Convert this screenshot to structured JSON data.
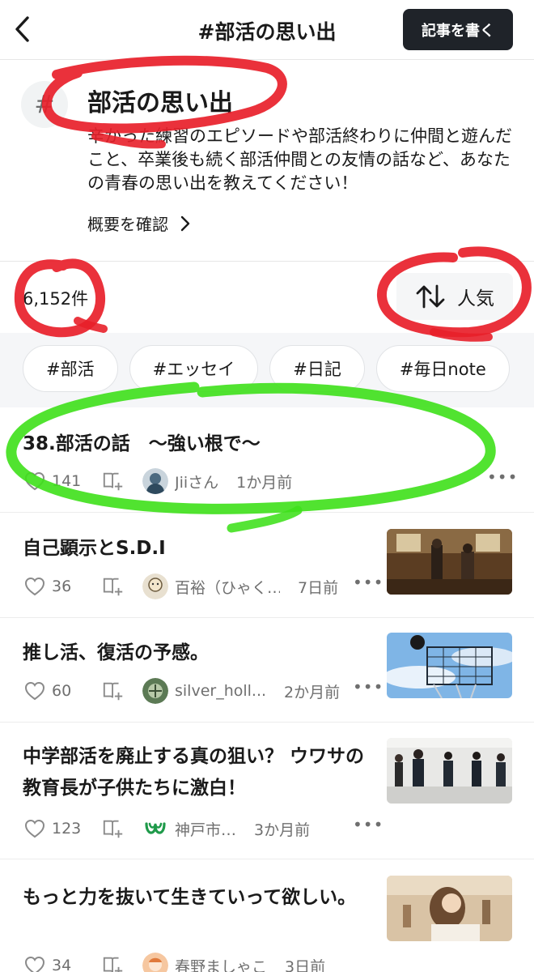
{
  "header": {
    "title": "#部活の思い出",
    "write_label": "記事を書く"
  },
  "tag": {
    "hash": "#",
    "title": "部活の思い出",
    "description": "辛かった練習のエピソードや部活終わりに仲間と遊んだこと、卒業後も続く部活仲間との友情の話など、あなたの青春の思い出を教えてください！",
    "overview_label": "概要を確認"
  },
  "list": {
    "count": "6,152件",
    "sort_label": "人気"
  },
  "chips": [
    "#部活",
    "#エッセイ",
    "#日記",
    "#毎日note"
  ],
  "articles": [
    {
      "title": "38.部活の話　〜強い根で〜",
      "likes": "141",
      "author": "Jiiさん",
      "time": "1か月前"
    },
    {
      "title": "自己顕示とS.D.I",
      "likes": "36",
      "author": "百裕（ひゃく…",
      "time": "7日前"
    },
    {
      "title": "推し活、復活の予感。",
      "likes": "60",
      "author": "silver_holl...",
      "time": "2か月前"
    },
    {
      "title": "中学部活を廃止する真の狙い？ ウワサの教育長が子供たちに激白！",
      "likes": "123",
      "author": "神戸市…",
      "time": "3か月前"
    },
    {
      "title": "もっと力を抜いて生きていって欲しい。",
      "likes": "34",
      "author": "春野ましゃこ",
      "time": "3日前"
    }
  ],
  "icons": {
    "back": "chevron-left-icon",
    "sort": "sort-arrows-icon",
    "heart": "heart-icon",
    "magazine": "magazine-add-icon",
    "more": "more-icon"
  },
  "colors": {
    "write_button": "#1f2329",
    "highlight_red": "#e8202a",
    "highlight_green": "#3ee01a",
    "chip_bar": "#f5f6f8"
  }
}
